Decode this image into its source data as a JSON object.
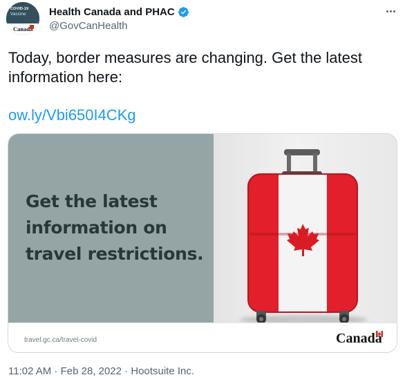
{
  "author": {
    "display_name": "Health Canada and PHAC",
    "handle": "@GovCanHealth",
    "avatar": {
      "line1": "COVID-19",
      "line2": "Vaccine",
      "wordmark": "Canada"
    },
    "verified_icon": "verified-badge-icon"
  },
  "tweet": {
    "text": "Today, border measures are changing. Get the latest\ninformation here:",
    "link": "ow.ly/Vbi650I4CKg"
  },
  "media": {
    "headline": "Get the latest information on travel restrictions.",
    "url": "travel.gc.ca/travel-covid",
    "wordmark": "Canada"
  },
  "meta": {
    "time": "11:02 AM · Feb 28, 2022 · Hootsuite Inc."
  },
  "colors": {
    "link": "#1d9bf0",
    "verified": "#1d9bf0",
    "panel": "#95a5a6",
    "flag_red": "#d52b1e"
  }
}
